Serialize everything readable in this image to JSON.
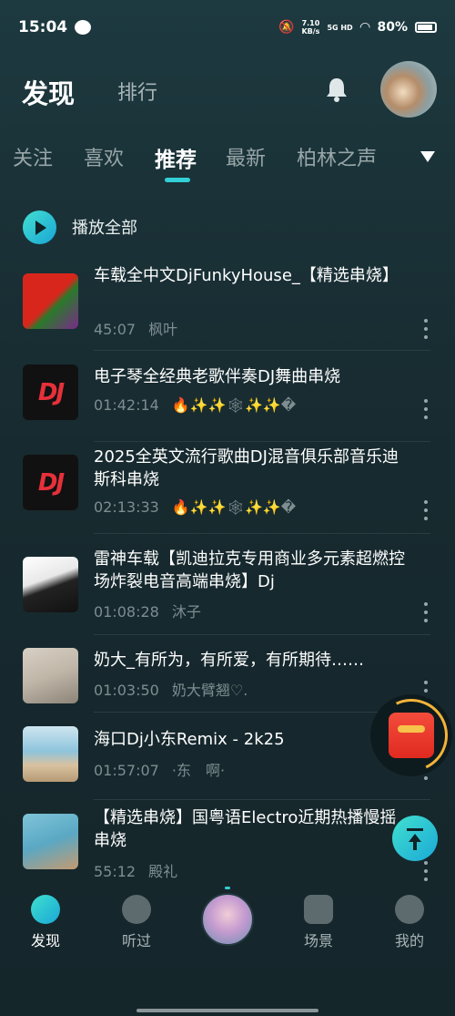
{
  "status_bar": {
    "time": "15:04",
    "net_speed_top": "7.10",
    "net_speed_bottom": "KB/s",
    "signal_label": "5G HD",
    "battery": "80%"
  },
  "header": {
    "title": "发现",
    "sub_tab": "排行"
  },
  "tabs": [
    "关注",
    "喜欢",
    "推荐",
    "最新",
    "柏林之声"
  ],
  "active_tab": "推荐",
  "play_all_label": "播放全部",
  "songs": [
    {
      "title": "车载全中文DjFunkyHouse_【精选串烧】",
      "duration": "45:07",
      "author": "枫叶",
      "cover": "flag"
    },
    {
      "title": "电子琴全经典老歌伴奏DJ舞曲串烧",
      "duration": "01:42:14",
      "author": "🔥✨✨🕸✨✨�",
      "cover": "dj"
    },
    {
      "title": "2025全英文流行歌曲DJ混音俱乐部音乐迪斯科串烧",
      "duration": "02:13:33",
      "author": "🔥✨✨🕸✨✨�",
      "cover": "dj"
    },
    {
      "title": "雷神车载【凯迪拉克专用商业多元素超燃控场炸裂电音高端串烧】Dj",
      "duration": "01:08:28",
      "author": "沐子",
      "cover": "anime"
    },
    {
      "title": "奶大_有所为，有所爱，有所期待……",
      "duration": "01:03:50",
      "author": "奶大臂翘♡.",
      "cover": "girl"
    },
    {
      "title": "海口Dj小东Remix - 2k25",
      "duration": "01:57:07",
      "author": "·东　啊·",
      "cover": "beach"
    },
    {
      "title": "【精选串烧】国粤语Electro近期热播慢摇串烧",
      "duration": "55:12",
      "author": "殿礼",
      "cover": "pool"
    }
  ],
  "dj_logo_text": "DJ",
  "bottom_nav": [
    {
      "label": "发现",
      "icon": "disc-icon",
      "active": true
    },
    {
      "label": "听过",
      "icon": "history-icon",
      "active": false
    },
    {
      "label": "场景",
      "icon": "scene-icon",
      "active": false
    },
    {
      "label": "我的",
      "icon": "profile-icon",
      "active": false
    }
  ],
  "colors": {
    "accent": "#33d0d6",
    "background": "#172a2f",
    "muted_text": "#7e8d90"
  }
}
